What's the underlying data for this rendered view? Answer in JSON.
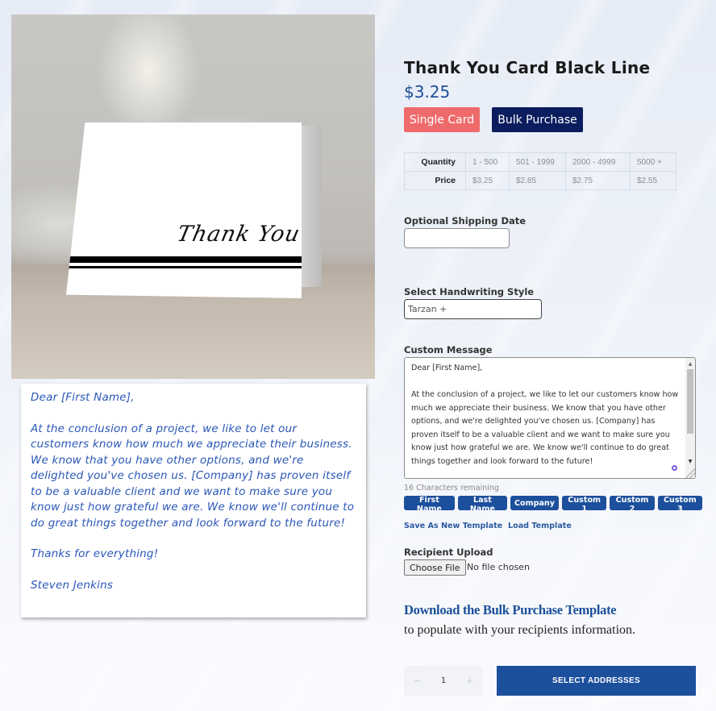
{
  "product": {
    "title": "Thank You Card Black Line",
    "price": "$3.25",
    "card_image_text": "Thank You",
    "purchase_modes": [
      "Single Card",
      "Bulk Purchase"
    ],
    "colors": {
      "single": "#ef6b6b",
      "bulk": "#0b1d5e",
      "accent": "#1c4f9c"
    }
  },
  "pricing_table": {
    "quantity_label": "Quantity",
    "price_label": "Price",
    "quantities": [
      "1 - 500",
      "501 - 1999",
      "2000 - 4999",
      "5000 +"
    ],
    "prices": [
      "$3.25",
      "$2.85",
      "$2.75",
      "$2.55"
    ]
  },
  "shipping": {
    "label": "Optional Shipping Date",
    "value": ""
  },
  "handwriting": {
    "label": "Select Handwriting Style",
    "selected": "Tarzan +"
  },
  "message": {
    "label": "Custom Message",
    "greeting": "Dear [First Name],",
    "body": "At the conclusion of a project, we like to let our customers know how much we appreciate their business. We know that you have other options, and we're delighted you've chosen us. [Company] has proven itself to be a valuable client and we want to make sure you know just how grateful we are. We know we'll continue to do great things together and look forward to the future!",
    "chars_remaining": "16 Characters remaining",
    "tokens": [
      "First Name",
      "Last Name",
      "Company",
      "Custom 1",
      "Custom 2",
      "Custom 3"
    ],
    "save_template": "Save As New Template",
    "load_template": "Load Template"
  },
  "preview": {
    "greeting": "Dear [First Name],",
    "body": "At the conclusion of a project, we like to let our customers know how much we appreciate their business. We know that you have other options, and we're delighted you've chosen us. [Company] has proven itself to be a valuable client and we want to make sure you know just how grateful we are. We know we'll continue to do great things together and look forward to the future!",
    "closing": "Thanks for everything!",
    "signature": "Steven Jenkins"
  },
  "upload": {
    "label": "Recipient Upload",
    "button": "Choose File",
    "status": "No file chosen"
  },
  "bulk_template": {
    "link": "Download the Bulk Purchase Template",
    "subtitle": "to populate with your recipients information."
  },
  "cart": {
    "quantity": "1",
    "minus": "−",
    "plus": "+",
    "select_addresses": "SELECT ADDRESSES"
  }
}
